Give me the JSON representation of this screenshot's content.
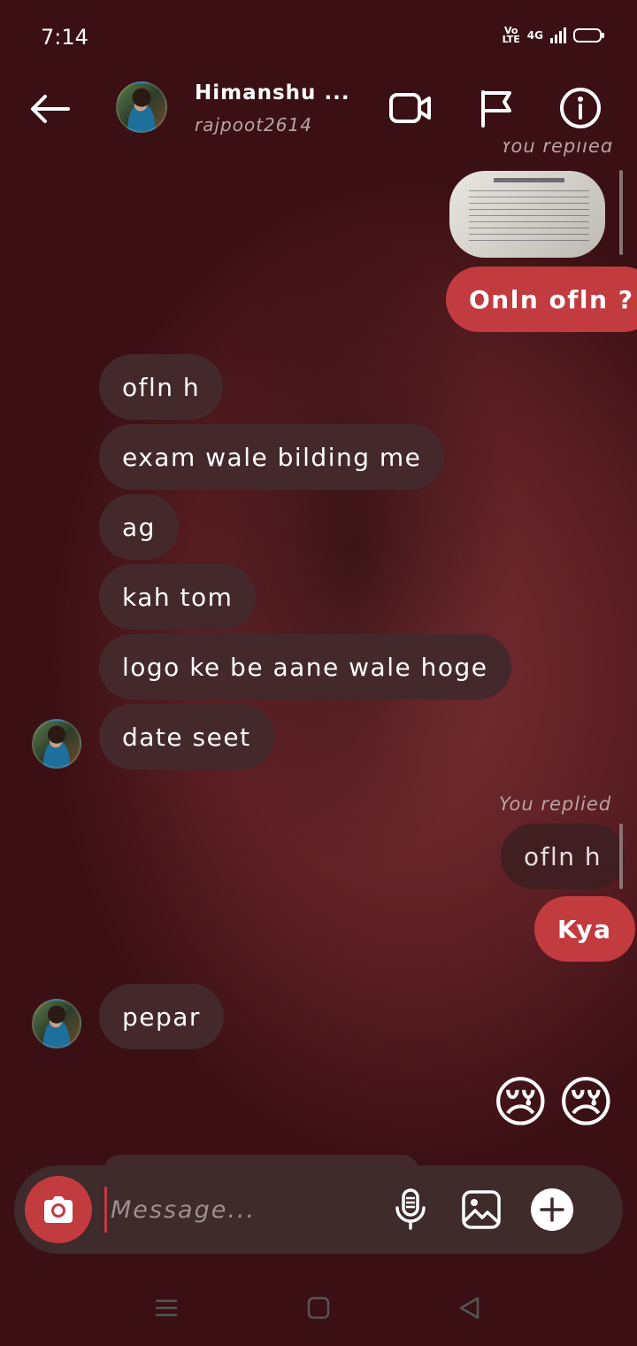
{
  "status_bar": {
    "time": "7:14",
    "volte": "Vo\nLTE",
    "network": "4G"
  },
  "header": {
    "name": "Himanshu ...",
    "username": "rajpoot2614"
  },
  "messages": {
    "top_replied": "You replied",
    "sent_1": "Onln ofln ?",
    "received": [
      "ofln h",
      "exam  wale bilding me",
      "ag",
      "kah tom",
      "logo ke be aane wale hoge",
      "date seet"
    ],
    "replied_label": "You replied",
    "reply_quote": "ofln h",
    "sent_2": "Kya",
    "received_2": "pepar",
    "emojis": [
      "😢",
      "😢"
    ]
  },
  "composer": {
    "placeholder": "Message..."
  },
  "colors": {
    "accent": "#c23b3f",
    "incoming_bubble": "#44292c"
  }
}
